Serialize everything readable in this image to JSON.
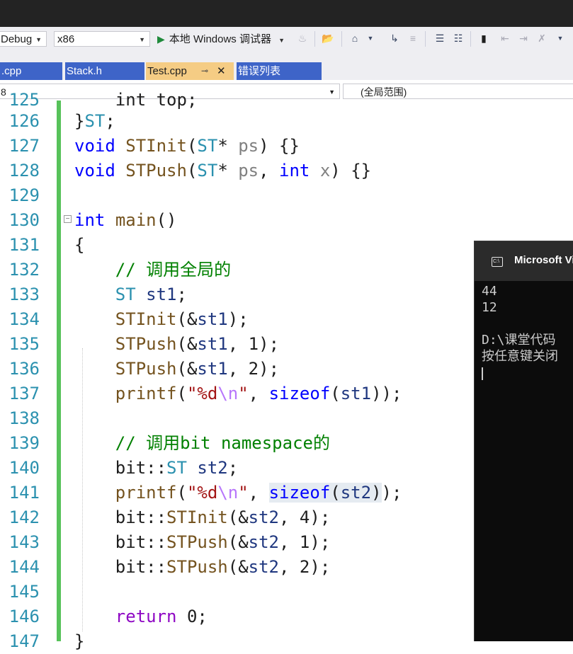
{
  "toolbar": {
    "config_value": "Debug",
    "platform_value": "x86",
    "run_label": "本地 Windows 调试器"
  },
  "tabs": [
    {
      "label": ".cpp"
    },
    {
      "label": "Stack.h"
    },
    {
      "label": "Test.cpp",
      "pin": "⊸",
      "close": "✕"
    },
    {
      "label": "错误列表"
    }
  ],
  "nav": {
    "left_value": "8",
    "scope_value": "(全局范围)"
  },
  "editor": {
    "line_numbers": [
      "125",
      "126",
      "127",
      "128",
      "129",
      "130",
      "131",
      "132",
      "133",
      "134",
      "135",
      "136",
      "137",
      "138",
      "139",
      "140",
      "141",
      "142",
      "143",
      "144",
      "145",
      "146",
      "147"
    ],
    "line_125_text": "    int top;",
    "colors": {
      "keyword": "#0000ff",
      "type": "#2b91af",
      "function": "#74531f",
      "comment": "#008000",
      "string": "#a31515",
      "gutter": "#57c25a"
    }
  },
  "console": {
    "title": "Microsoft Vi",
    "lines": [
      "44",
      "12",
      "",
      "D:\\课堂代码",
      "按任意键关闭"
    ]
  }
}
